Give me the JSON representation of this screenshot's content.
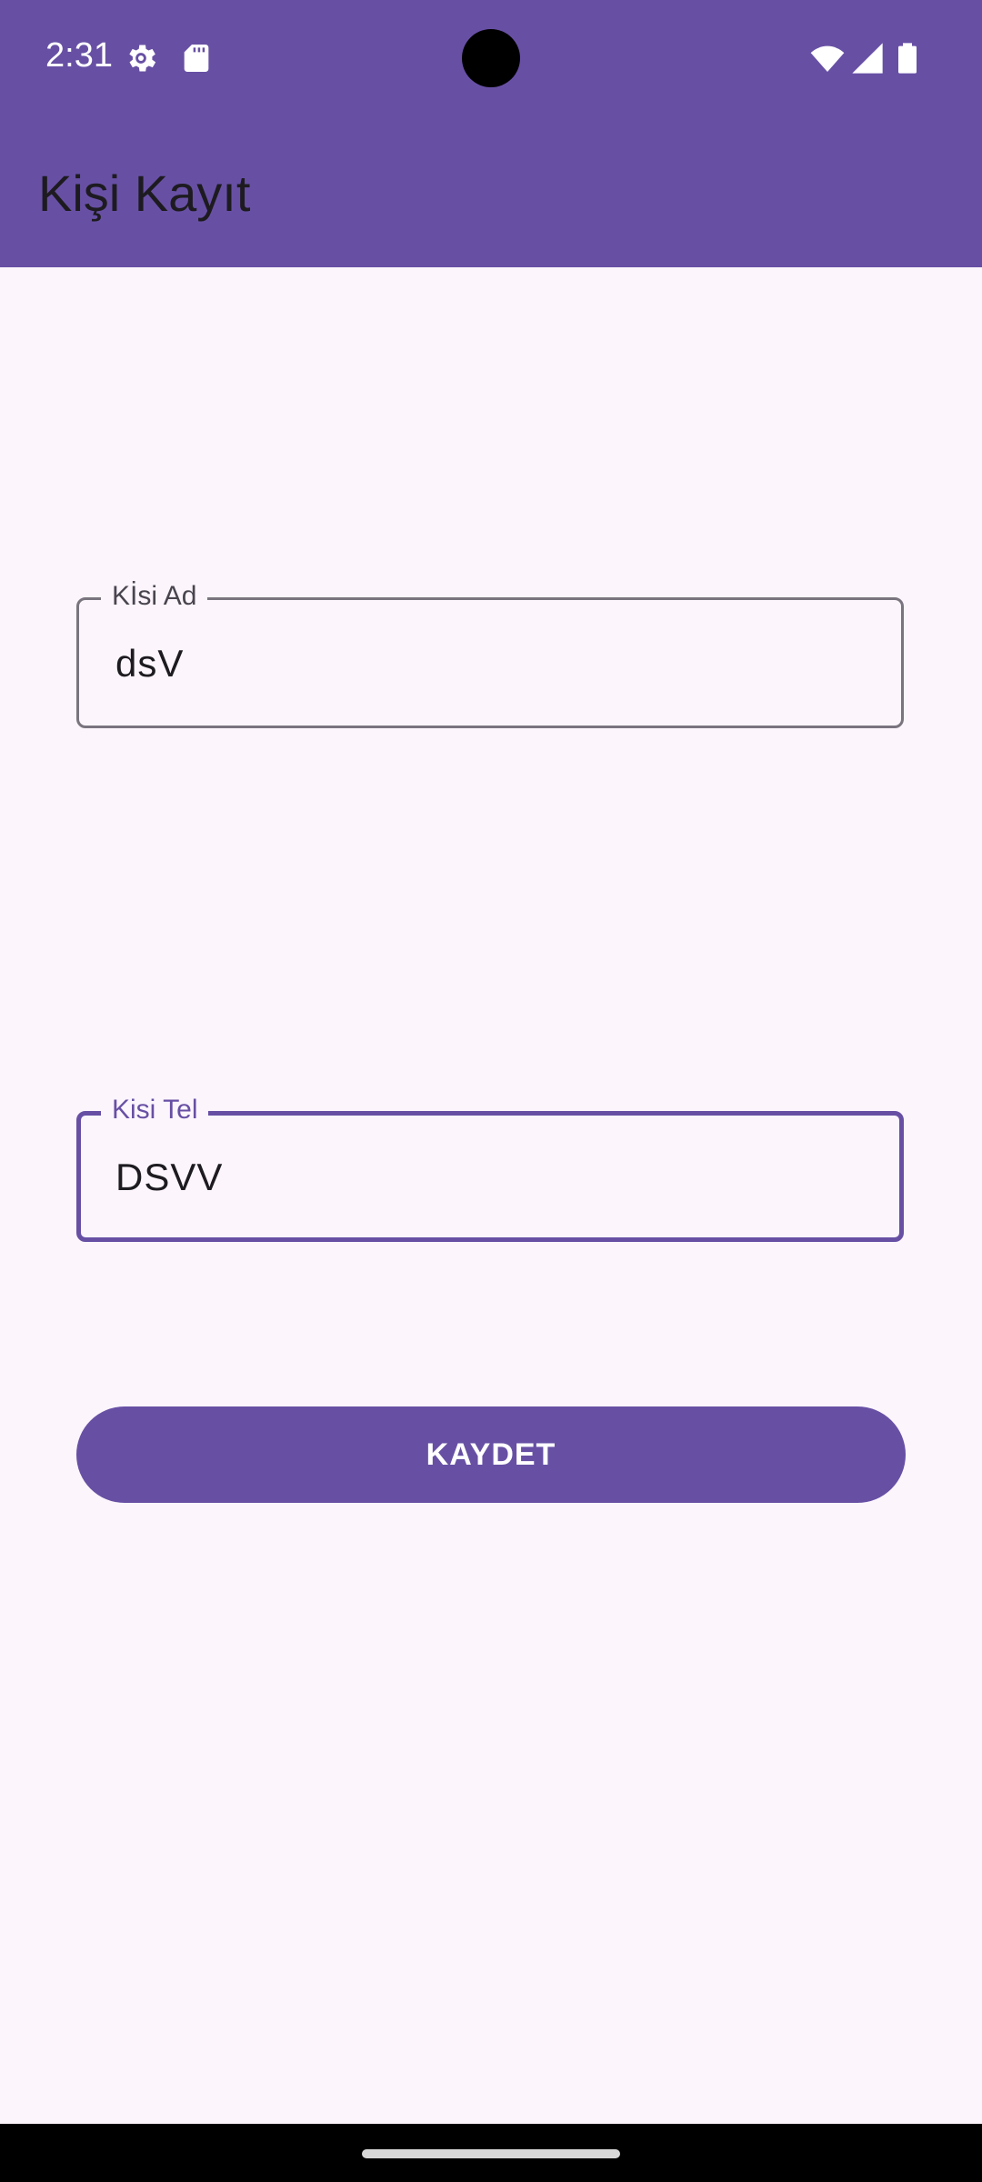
{
  "status_bar": {
    "time": "2:31",
    "icons": [
      "settings-gear-icon",
      "sd-card-icon",
      "wifi-icon",
      "cellular-signal-icon",
      "battery-icon"
    ]
  },
  "app_bar": {
    "title": "Kişi Kayıt"
  },
  "form": {
    "name_field": {
      "label": "Kİsi Ad",
      "value": "dsV"
    },
    "phone_field": {
      "label": "Kisi Tel",
      "value": "DSVV"
    },
    "save_label": "KAYDET"
  },
  "colors": {
    "primary": "#6750a4",
    "background": "#fcf5fc",
    "on_surface": "#1d1b20",
    "outline": "#79747e"
  }
}
